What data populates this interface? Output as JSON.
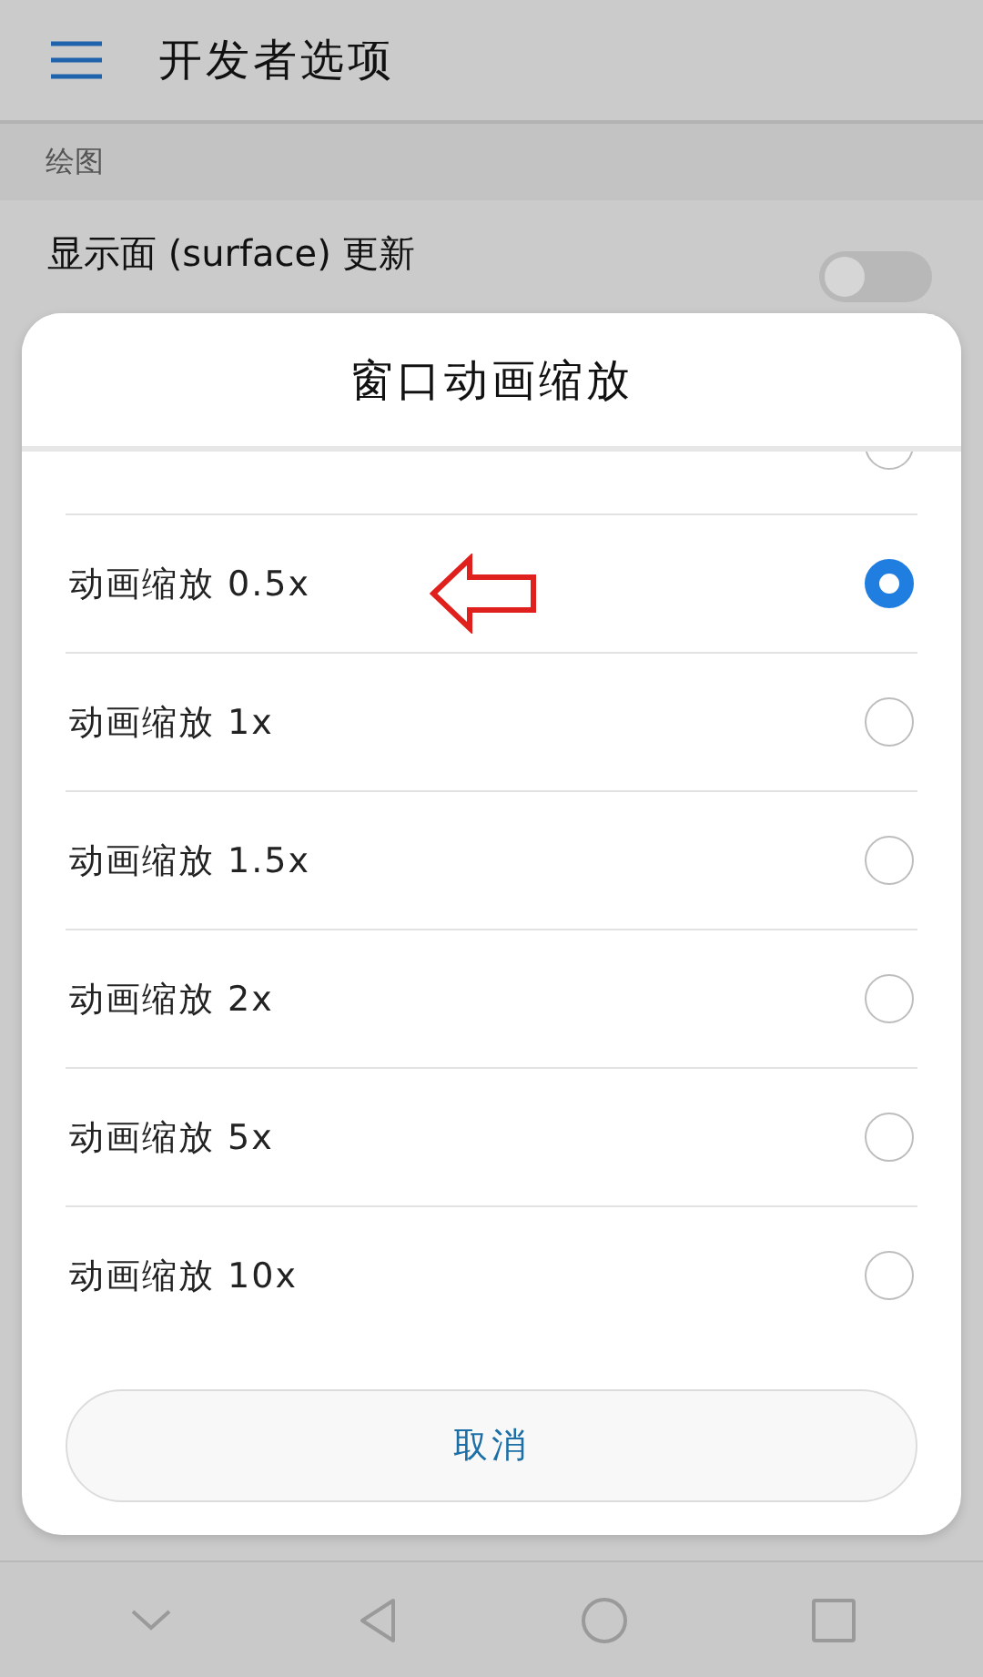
{
  "app_bar": {
    "title": "开发者选项"
  },
  "section": {
    "title": "绘图"
  },
  "setting": {
    "title": "显示面 (surface) 更新",
    "on": false
  },
  "dialog": {
    "title": "窗口动画缩放",
    "options": [
      {
        "selected": false
      },
      {
        "label": "动画缩放 0.5x",
        "selected": true
      },
      {
        "label": "动画缩放 1x",
        "selected": false
      },
      {
        "label": "动画缩放 1.5x",
        "selected": false
      },
      {
        "label": "动画缩放 2x",
        "selected": false
      },
      {
        "label": "动画缩放 5x",
        "selected": false
      },
      {
        "label": "动画缩放 10x",
        "selected": false
      }
    ],
    "cancel": "取消"
  }
}
